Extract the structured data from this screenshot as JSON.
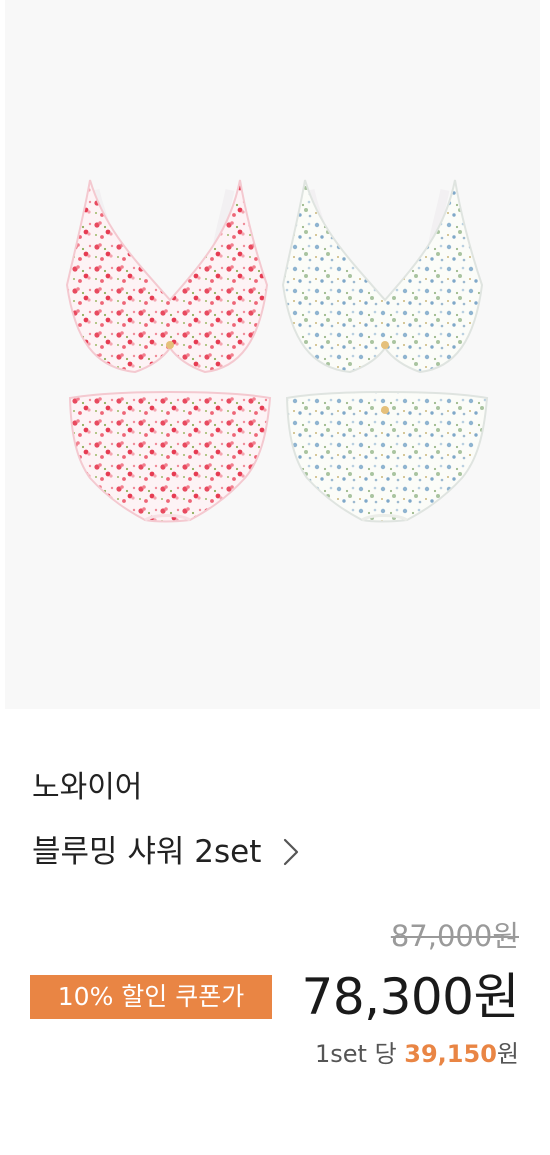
{
  "product": {
    "brand": "노와이어",
    "title": "블루밍 샤워 2set",
    "original_price": "87,000원",
    "coupon_label": "10% 할인 쿠폰가",
    "sale_price": "78,300원",
    "per_set_prefix": "1set 당 ",
    "per_set_value": "39,150",
    "per_set_suffix": "원"
  },
  "colors": {
    "accent": "#e98544",
    "hero_bg": "#f8f8f8",
    "pink_set": "#e84a5f",
    "blue_set": "#7fa8c9"
  },
  "icons": {
    "title_arrow": "chevron-right-icon"
  }
}
